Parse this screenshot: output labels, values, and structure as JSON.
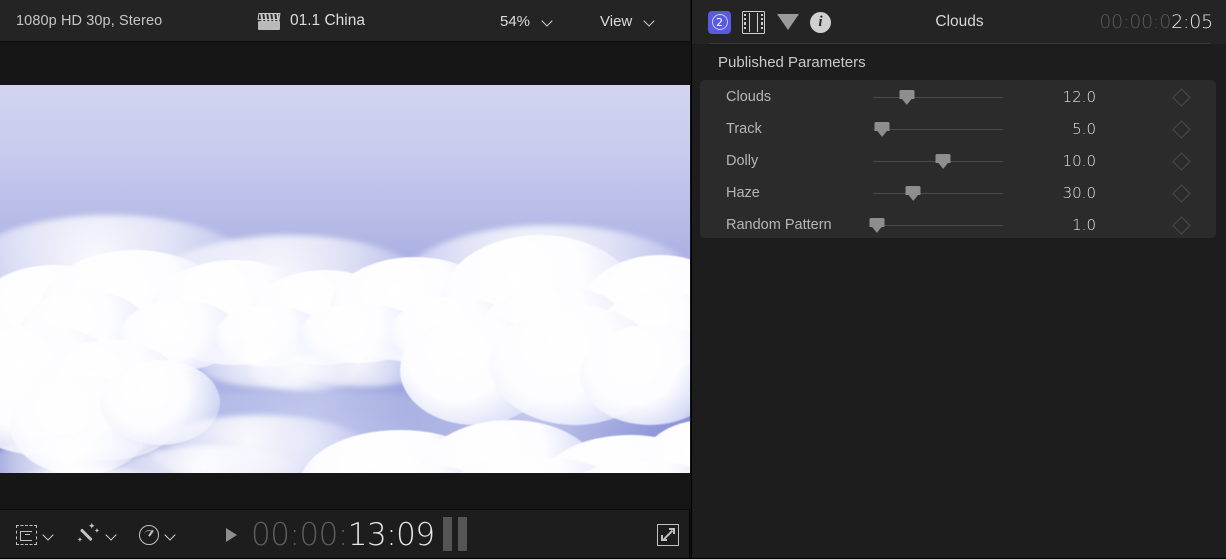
{
  "viewer": {
    "topbar": {
      "format_label": "1080p HD 30p, Stereo",
      "clip_icon": "clapperboard-icon",
      "clip_name": "01.1 China",
      "zoom_level": "54%",
      "zoom_chevron_icon": "chevron-down-icon",
      "view_label": "View",
      "view_chevron_icon": "chevron-down-icon"
    },
    "bottombar": {
      "crop_icon": "crop-transform-icon",
      "crop_chevron_icon": "chevron-down-icon",
      "effects_icon": "magic-wand-icon",
      "effects_chevron_icon": "chevron-down-icon",
      "retime_icon": "speed-gauge-icon",
      "retime_chevron_icon": "chevron-down-icon",
      "play_icon": "play-triangle-icon",
      "timecode_dim": "00:00:",
      "timecode_bright": "13:09",
      "pause_icon": "pause-bars-icon",
      "expand_icon": "expand-fullscreen-icon"
    },
    "preview": {
      "content": "clouds-video-frame"
    }
  },
  "inspector": {
    "topbar": {
      "icons": [
        {
          "name": "effects-badge-icon",
          "badge": "2"
        },
        {
          "name": "film-strip-icon"
        },
        {
          "name": "triangle-down-icon"
        },
        {
          "name": "info-icon",
          "glyph": "i"
        }
      ],
      "title": "Clouds",
      "timecode_dim": "00:00:0",
      "timecode_bright": "2:05"
    },
    "section_header": "Published Parameters",
    "parameters": [
      {
        "name": "Clouds",
        "value": "12.0",
        "slider_pct": 26,
        "keyframe_icon": "keyframe-diamond-icon"
      },
      {
        "name": "Track",
        "value": "5.0",
        "slider_pct": 7,
        "keyframe_icon": "keyframe-diamond-icon"
      },
      {
        "name": "Dolly",
        "value": "10.0",
        "slider_pct": 54,
        "keyframe_icon": "keyframe-diamond-icon"
      },
      {
        "name": "Haze",
        "value": "30.0",
        "slider_pct": 31,
        "keyframe_icon": "keyframe-diamond-icon"
      },
      {
        "name": "Random Pattern",
        "value": "1.0",
        "slider_pct": 3,
        "keyframe_icon": "keyframe-diamond-icon"
      }
    ]
  },
  "colors": {
    "accent_badge": "#5a5ae0",
    "panel_bg": "#1d1d1d",
    "topbar_bg": "#242424",
    "group_bg": "#2b2b2b",
    "sky_top": "#d2d4f0",
    "sky_bottom": "#5a64bf"
  }
}
